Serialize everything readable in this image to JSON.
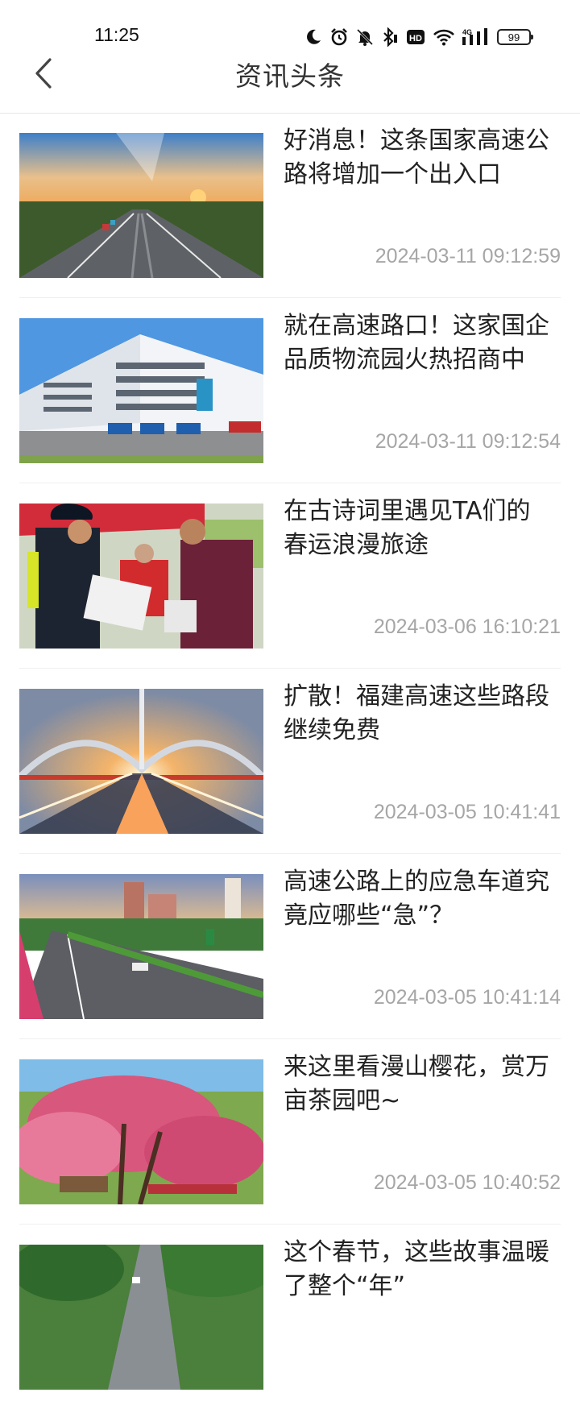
{
  "status_bar": {
    "time": "11:25",
    "network": "4G",
    "battery": "99",
    "icons": [
      "moon-icon",
      "alarm-icon",
      "mute-bell-icon",
      "bluetooth-icon",
      "hd-icon",
      "wifi-icon",
      "signal-icon",
      "battery-icon"
    ]
  },
  "header": {
    "title": "资讯头条",
    "back_icon": "chevron-left-icon"
  },
  "news": [
    {
      "title": "好消息！这条国家高速公路将增加一个出入口",
      "time": "2024-03-11 09:12:59"
    },
    {
      "title": "就在高速路口！这家国企品质物流园火热招商中",
      "time": "2024-03-11 09:12:54"
    },
    {
      "title": "在古诗词里遇见TA们的春运浪漫旅途",
      "time": "2024-03-06 16:10:21"
    },
    {
      "title": "扩散！福建高速这些路段继续免费",
      "time": "2024-03-05 10:41:41"
    },
    {
      "title": "高速公路上的应急车道究竟应哪些“急”？",
      "time": "2024-03-05 10:41:14"
    },
    {
      "title": "来这里看漫山樱花，赏万亩茶园吧~",
      "time": "2024-03-05 10:40:52"
    },
    {
      "title": "这个春节，这些故事温暖了整个“年”",
      "time": ""
    }
  ]
}
